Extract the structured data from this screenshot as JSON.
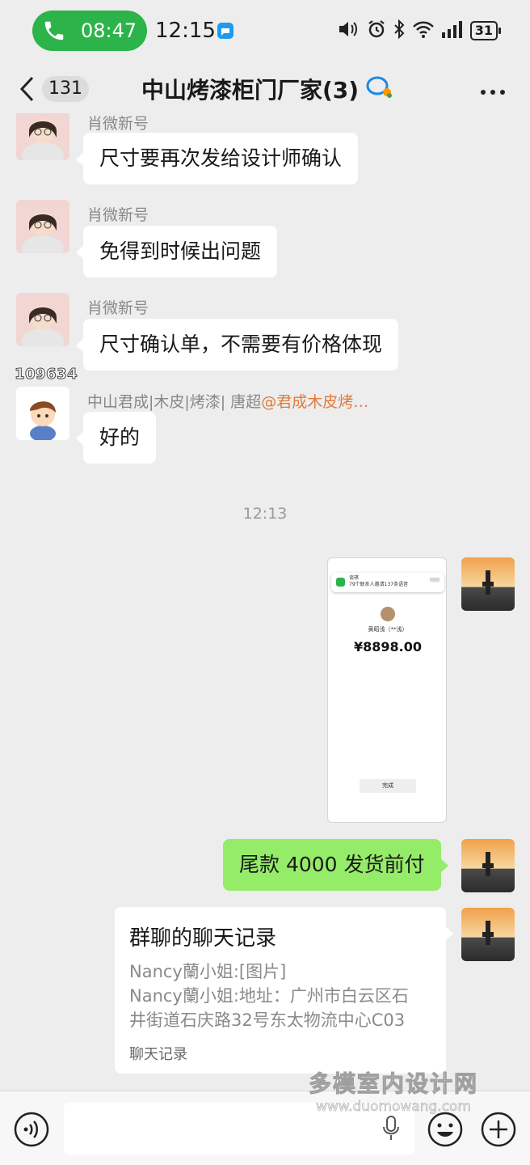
{
  "status_bar": {
    "call_time": "08:47",
    "clock": "12:15",
    "battery": "31"
  },
  "header": {
    "unread_count": "131",
    "title": "中山烤漆柜门厂家(3)"
  },
  "messages": [
    {
      "sender": "肖微新号",
      "text": "尺寸要再次发给设计师确认",
      "direction": "in"
    },
    {
      "sender": "肖微新号",
      "text": "免得到时候出问题",
      "direction": "in"
    },
    {
      "sender": "肖微新号",
      "text": "尺寸确认单，不需要有价格体现",
      "direction": "in"
    },
    {
      "sender": "中山君成|木皮|烤漆| 唐超",
      "mention": "@君成木皮烤…",
      "text": "好的",
      "direction": "in"
    }
  ],
  "overlay_id": "109634",
  "time_separator": "12:13",
  "image_message": {
    "notification_title": "谈祺",
    "notification_text": "79个联系人邀请137条语音",
    "notification_time": "刚刚",
    "payer_name": "黄昭浅（**浅）",
    "amount": "¥8898.00",
    "done_button": "完成"
  },
  "outgoing_text": "尾款 4000 发货前付",
  "record_card": {
    "title": "群聊的聊天记录",
    "line1": "Nancy蘭小姐:[图片]",
    "line2": "Nancy蘭小姐:地址：广州市白云区石",
    "line3": "井街道石庆路32号东太物流中心C03",
    "footer": "聊天记录"
  },
  "watermark": {
    "main": "多模室内设计网",
    "url": "www.duomowang.com"
  },
  "colors": {
    "call_green": "#2cb44a",
    "outgoing_bubble": "#95ec69",
    "mention_orange": "#e07a3a",
    "background": "#ededed"
  },
  "icons": [
    "phone-icon",
    "message-app-icon",
    "volume-icon",
    "alarm-icon",
    "bluetooth-icon",
    "wifi-icon",
    "signal-icon",
    "back-chevron-icon",
    "group-chat-icon",
    "more-icon",
    "voice-mode-icon",
    "microphone-icon",
    "emoji-icon",
    "plus-icon"
  ]
}
